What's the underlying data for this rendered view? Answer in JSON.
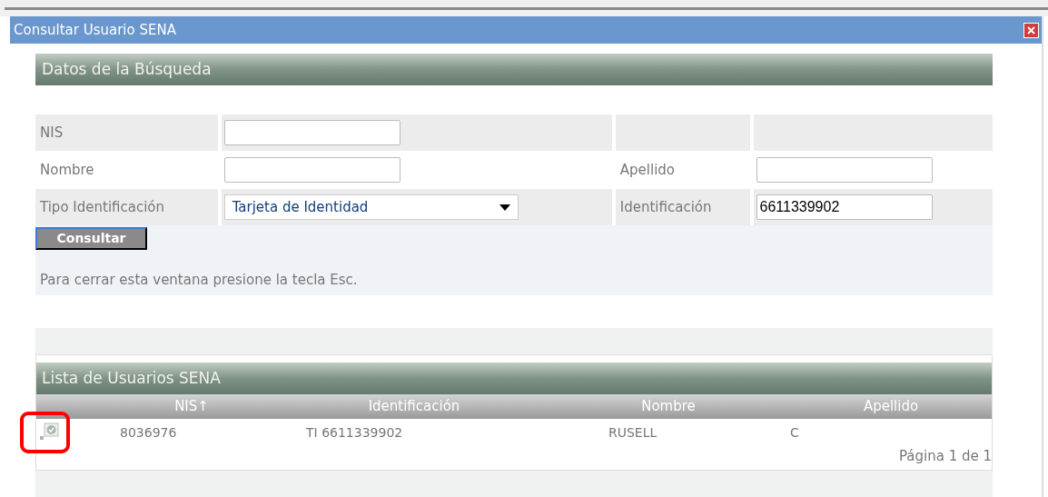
{
  "window": {
    "title": "Consultar Usuario SENA"
  },
  "search": {
    "title": "Datos de la Búsqueda",
    "rows": [
      [
        {
          "label": "NIS",
          "kind": "text"
        },
        {
          "kind": "empty"
        }
      ],
      [
        {
          "label": "Nombre",
          "kind": "text"
        },
        {
          "label": "Apellido",
          "kind": "text"
        }
      ],
      [
        {
          "label": "Tipo Identificación",
          "kind": "select",
          "value": "Tarjeta de Identidad"
        },
        {
          "label": "Identificación",
          "kind": "text",
          "value": "6611339902"
        }
      ]
    ],
    "button": "Consultar",
    "note": "Para cerrar esta ventana presione la tecla Esc."
  },
  "results": {
    "title": "Lista de Usuarios SENA",
    "columns": [
      "NIS↑",
      "Identificación",
      "Nombre",
      "Apellido"
    ],
    "rows": [
      {
        "highlighted": true,
        "cells": [
          "8036976",
          "TI 6611339902",
          "RUSELL",
          "C"
        ]
      }
    ],
    "pagination": "Página 1 de 1"
  }
}
